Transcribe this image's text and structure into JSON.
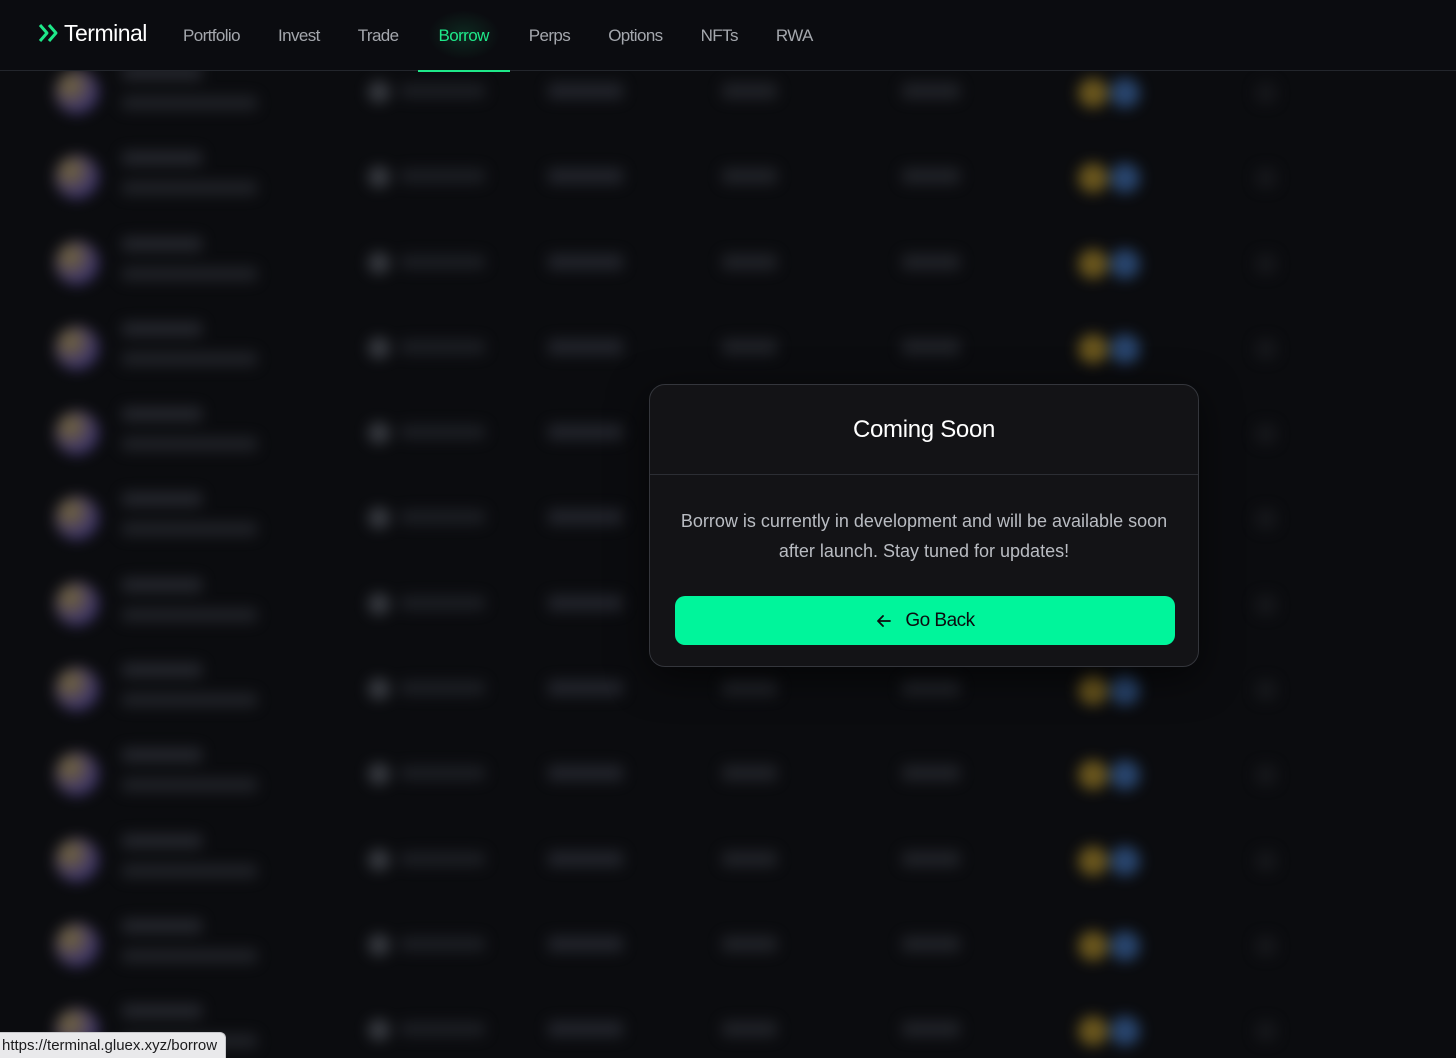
{
  "brand": {
    "name": "Terminal",
    "icon": "double-chevron-right-icon",
    "color": "#1ee889"
  },
  "nav": {
    "items": [
      {
        "label": "Portfolio",
        "active": false
      },
      {
        "label": "Invest",
        "active": false
      },
      {
        "label": "Trade",
        "active": false
      },
      {
        "label": "Borrow",
        "active": true
      },
      {
        "label": "Perps",
        "active": false
      },
      {
        "label": "Options",
        "active": false
      },
      {
        "label": "NFTs",
        "active": false
      },
      {
        "label": "RWA",
        "active": false
      }
    ]
  },
  "modal": {
    "title": "Coming Soon",
    "message": "Borrow is currently in development and will be available soon after launch. Stay tuned for updates!",
    "button_label": "Go Back",
    "button_icon": "arrow-left-icon",
    "button_color": "#00f59b"
  },
  "status_url": "https://terminal.gluex.xyz/borrow"
}
